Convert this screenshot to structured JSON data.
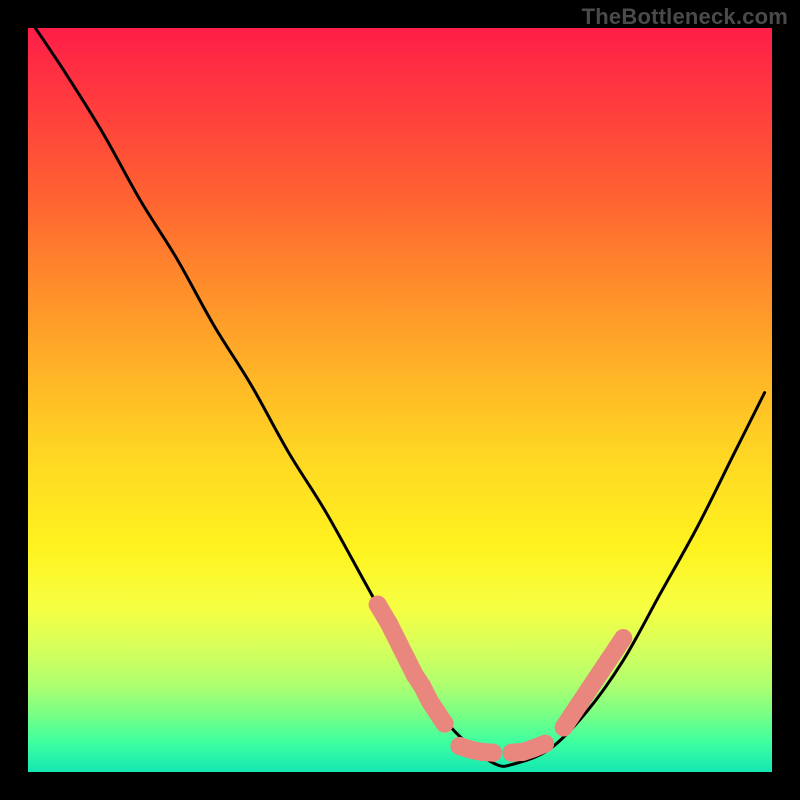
{
  "watermark": "TheBottleneck.com",
  "chart_data": {
    "type": "line",
    "title": "",
    "xlabel": "",
    "ylabel": "",
    "xlim": [
      0,
      100
    ],
    "ylim": [
      0,
      100
    ],
    "grid": false,
    "series": [
      {
        "name": "curve",
        "x": [
          1,
          5,
          10,
          15,
          20,
          25,
          30,
          35,
          40,
          45,
          50,
          53,
          56,
          60,
          63,
          65,
          70,
          75,
          80,
          85,
          90,
          95,
          99
        ],
        "y": [
          100,
          94,
          86,
          77,
          69,
          60,
          52,
          43,
          35,
          26,
          17,
          12,
          7,
          3,
          1,
          1,
          3,
          8,
          15,
          24,
          33,
          43,
          51
        ],
        "color": "#000000"
      }
    ],
    "marker_clusters": [
      {
        "name": "left-cluster",
        "color": "#e9867e",
        "points": [
          {
            "x": 47,
            "y": 22.5
          },
          {
            "x": 48.5,
            "y": 20
          },
          {
            "x": 50,
            "y": 17
          },
          {
            "x": 51,
            "y": 15
          },
          {
            "x": 52,
            "y": 13
          },
          {
            "x": 53,
            "y": 11.5
          },
          {
            "x": 54,
            "y": 9.5
          },
          {
            "x": 55,
            "y": 8
          },
          {
            "x": 56,
            "y": 6.5
          }
        ]
      },
      {
        "name": "bottom-left-bar",
        "color": "#e9867e",
        "points": [
          {
            "x": 58,
            "y": 3.5
          },
          {
            "x": 59.5,
            "y": 3
          },
          {
            "x": 61,
            "y": 2.7
          },
          {
            "x": 62.5,
            "y": 2.6
          }
        ]
      },
      {
        "name": "bottom-right-bar",
        "color": "#e9867e",
        "points": [
          {
            "x": 65,
            "y": 2.6
          },
          {
            "x": 66.5,
            "y": 2.7
          },
          {
            "x": 68,
            "y": 3.2
          },
          {
            "x": 69.5,
            "y": 3.8
          }
        ]
      },
      {
        "name": "right-cluster",
        "color": "#e9867e",
        "points": [
          {
            "x": 72,
            "y": 6
          },
          {
            "x": 73,
            "y": 7.5
          },
          {
            "x": 74,
            "y": 9
          },
          {
            "x": 75,
            "y": 10.5
          },
          {
            "x": 76,
            "y": 12
          },
          {
            "x": 77,
            "y": 13.5
          },
          {
            "x": 78,
            "y": 15
          },
          {
            "x": 79,
            "y": 16.5
          },
          {
            "x": 80,
            "y": 18
          }
        ]
      }
    ]
  }
}
